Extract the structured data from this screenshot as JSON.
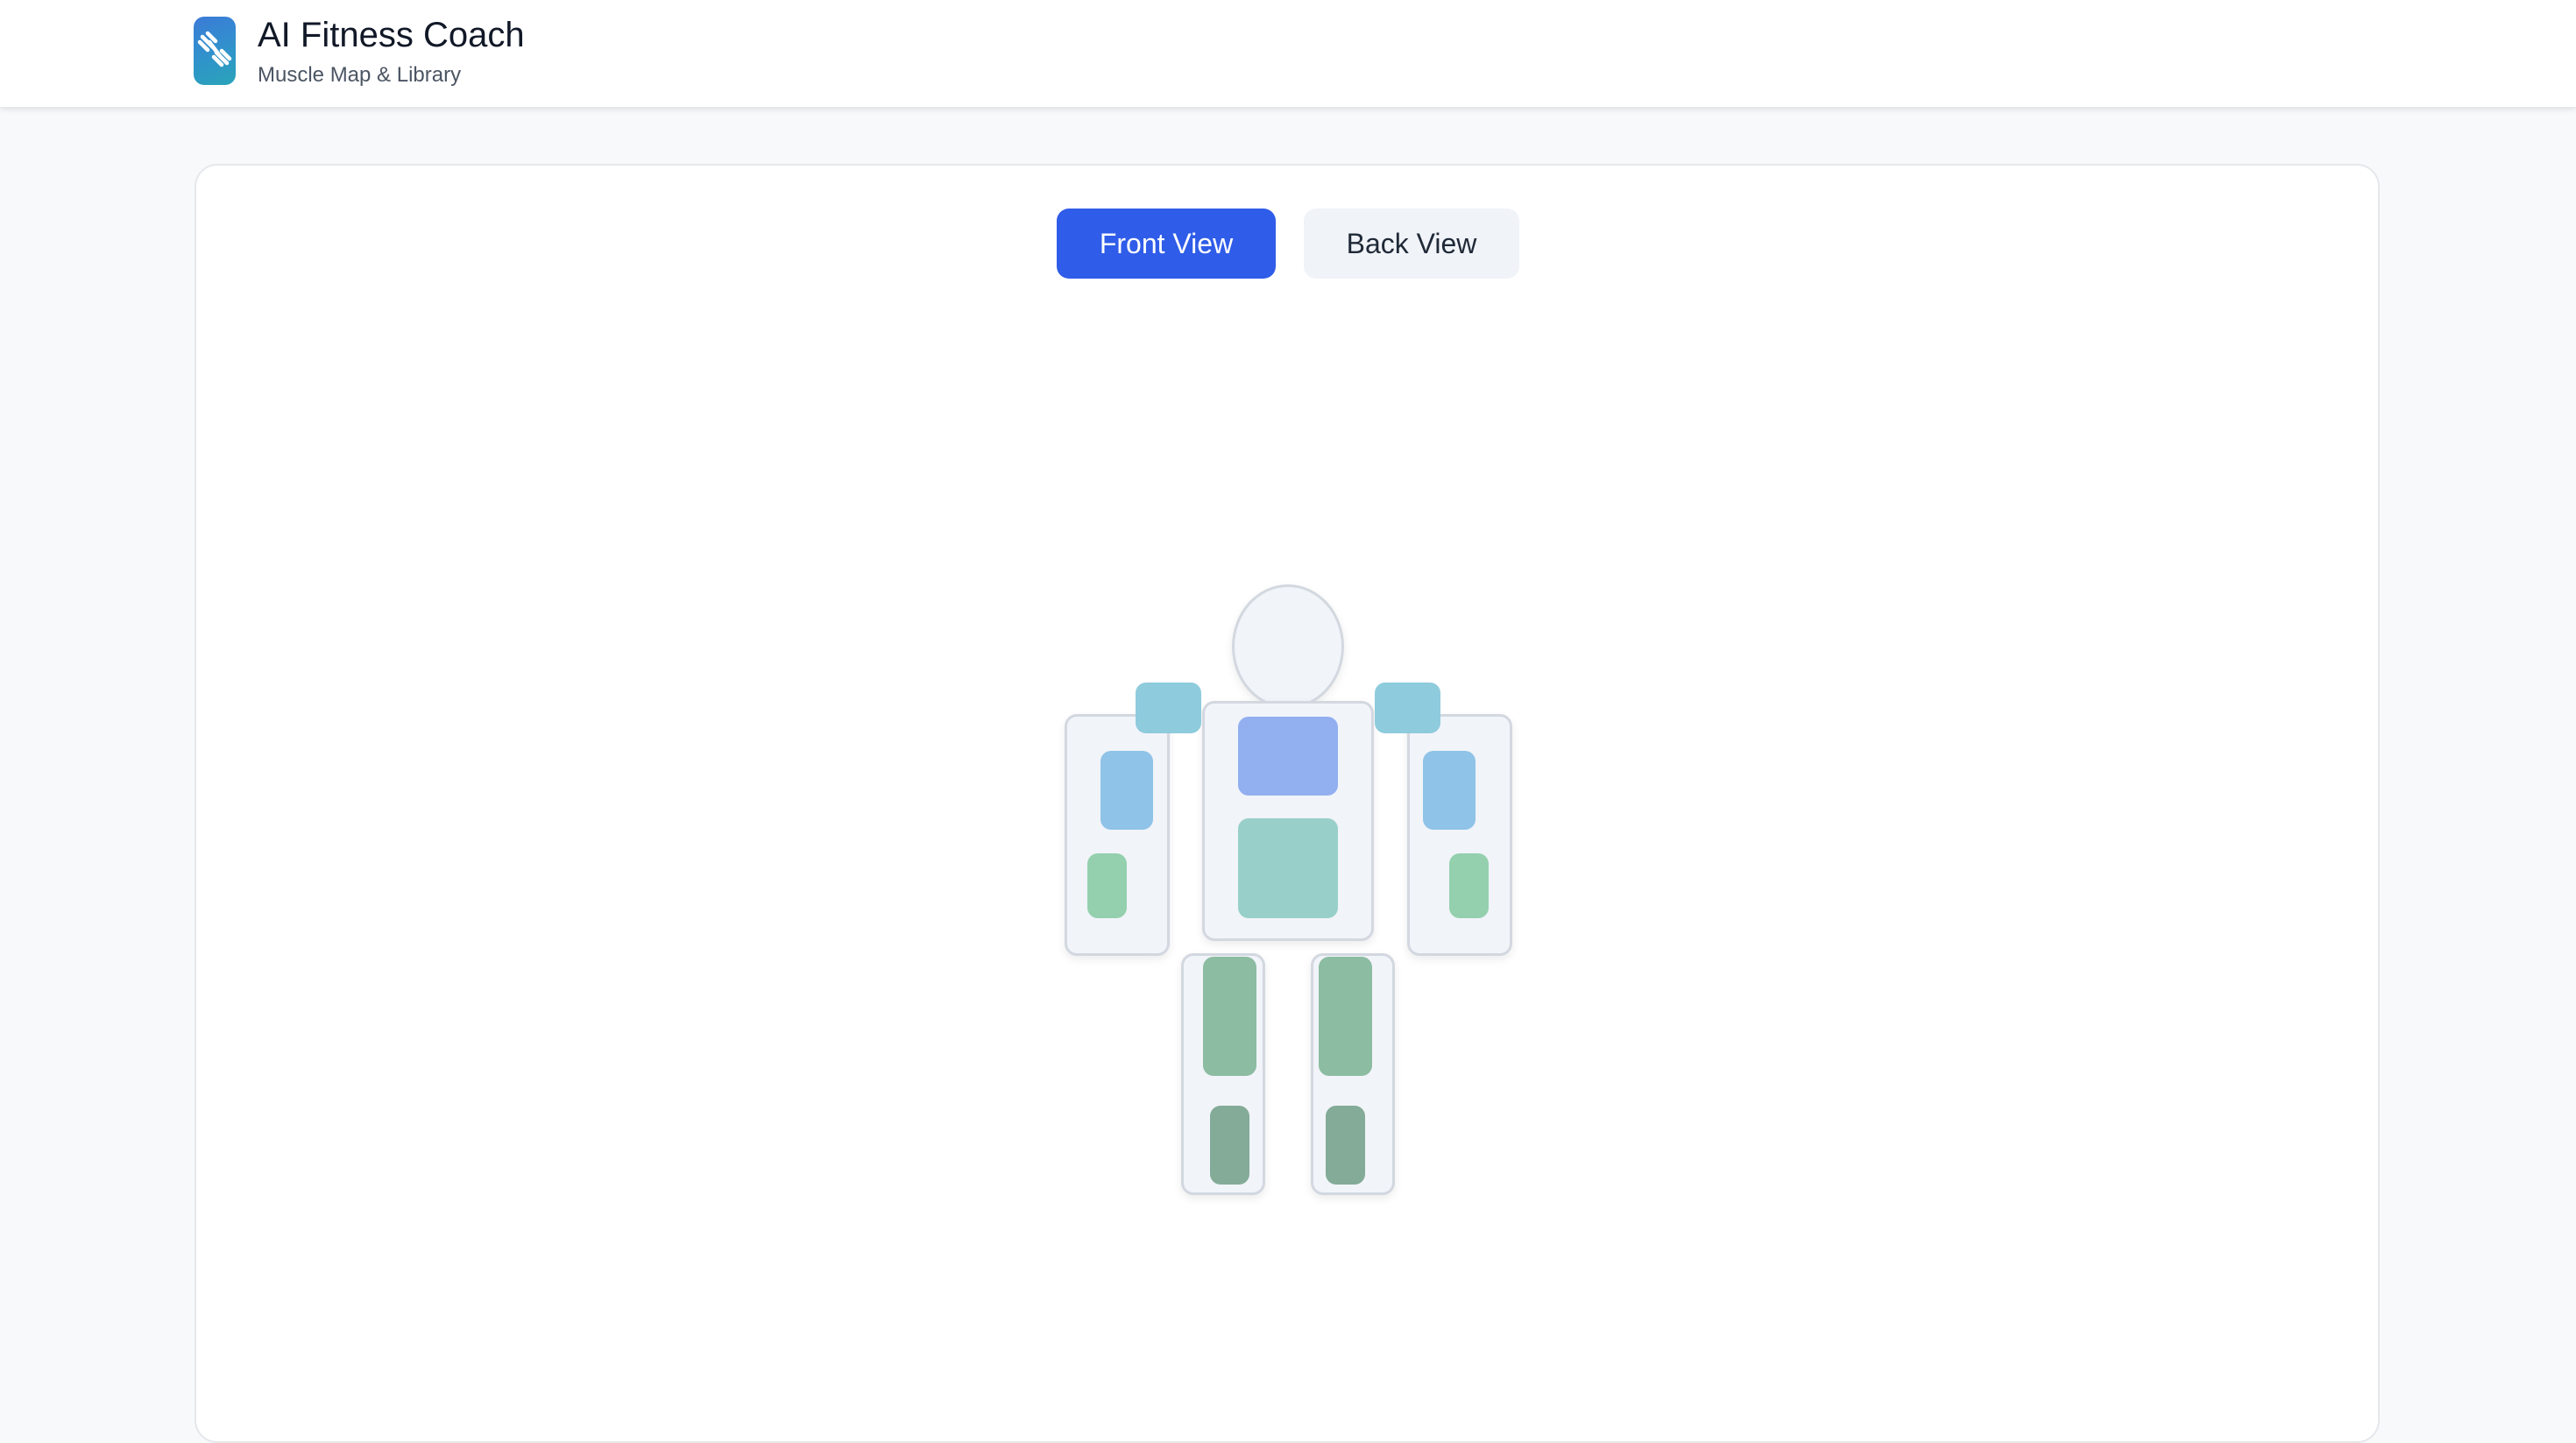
{
  "header": {
    "title": "AI Fitness Coach",
    "subtitle": "Muscle Map & Library",
    "logo_icon": "dumbbell-icon"
  },
  "view_toggle": {
    "front_label": "Front View",
    "back_label": "Back View",
    "active": "front"
  },
  "colors": {
    "accent": "#2f5ce8",
    "shoulders": "#8ecbdd",
    "chest": "#92aff0",
    "abs": "#98d0c9",
    "biceps": "#8fc3e8",
    "forearms": "#94d0ae",
    "quads": "#8cbca1",
    "calves": "#83ab97",
    "body_fill": "#f1f4f9",
    "body_stroke": "#d3d8e0"
  }
}
